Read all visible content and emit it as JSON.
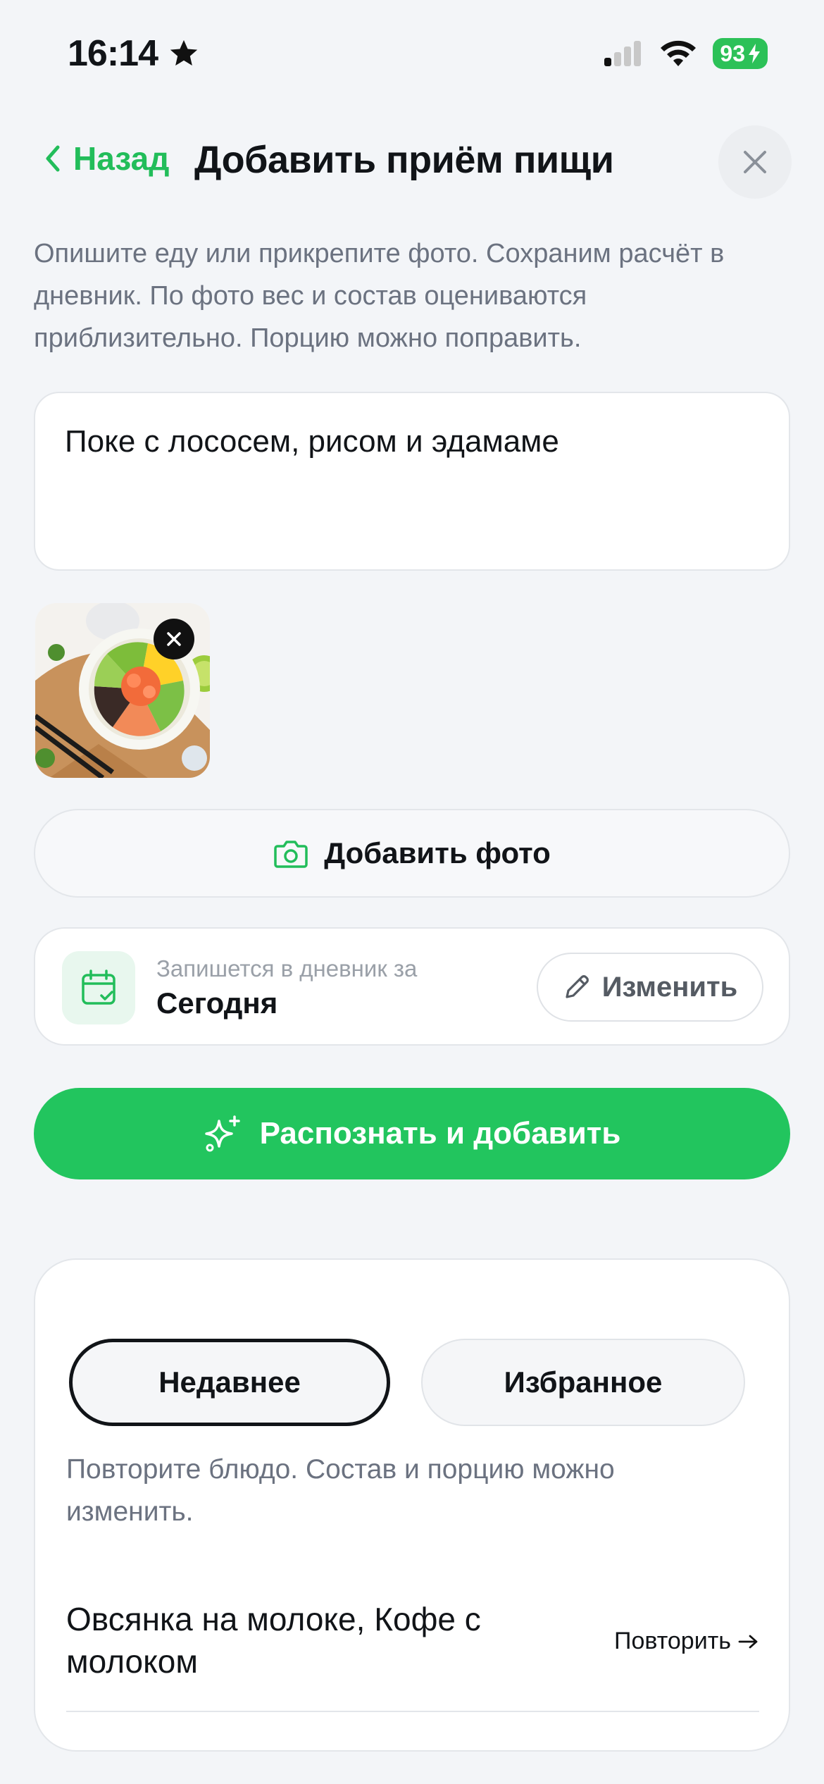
{
  "status_bar": {
    "time": "16:14",
    "battery": "93"
  },
  "header": {
    "back_label": "Назад",
    "title": "Добавить приём пищи"
  },
  "description": "Опишите еду или прикрепите фото. Сохраним расчёт в дневник. По фото вес и состав оцениваются приблизительно. Порцию можно поправить.",
  "meal_input": {
    "value": "Поке с лососем, рисом и эдамаме"
  },
  "photo": {
    "alt": "Поке"
  },
  "add_photo_label": "Добавить фото",
  "diary_date": {
    "caption": "Запишется в дневник за",
    "value": "Сегодня",
    "edit_label": "Изменить"
  },
  "primary_button": "Распознать и добавить",
  "history": {
    "tabs": [
      {
        "label": "Недавнее",
        "active": true
      },
      {
        "label": "Избранное",
        "active": false
      }
    ],
    "hint": "Повторите блюдо. Состав и порцию можно изменить.",
    "items": [
      {
        "name": "Овсянка на молоке, Кофе с молоком",
        "action": "Повторить"
      }
    ]
  },
  "colors": {
    "accent": "#22c55e",
    "background": "#f3f5f8"
  }
}
